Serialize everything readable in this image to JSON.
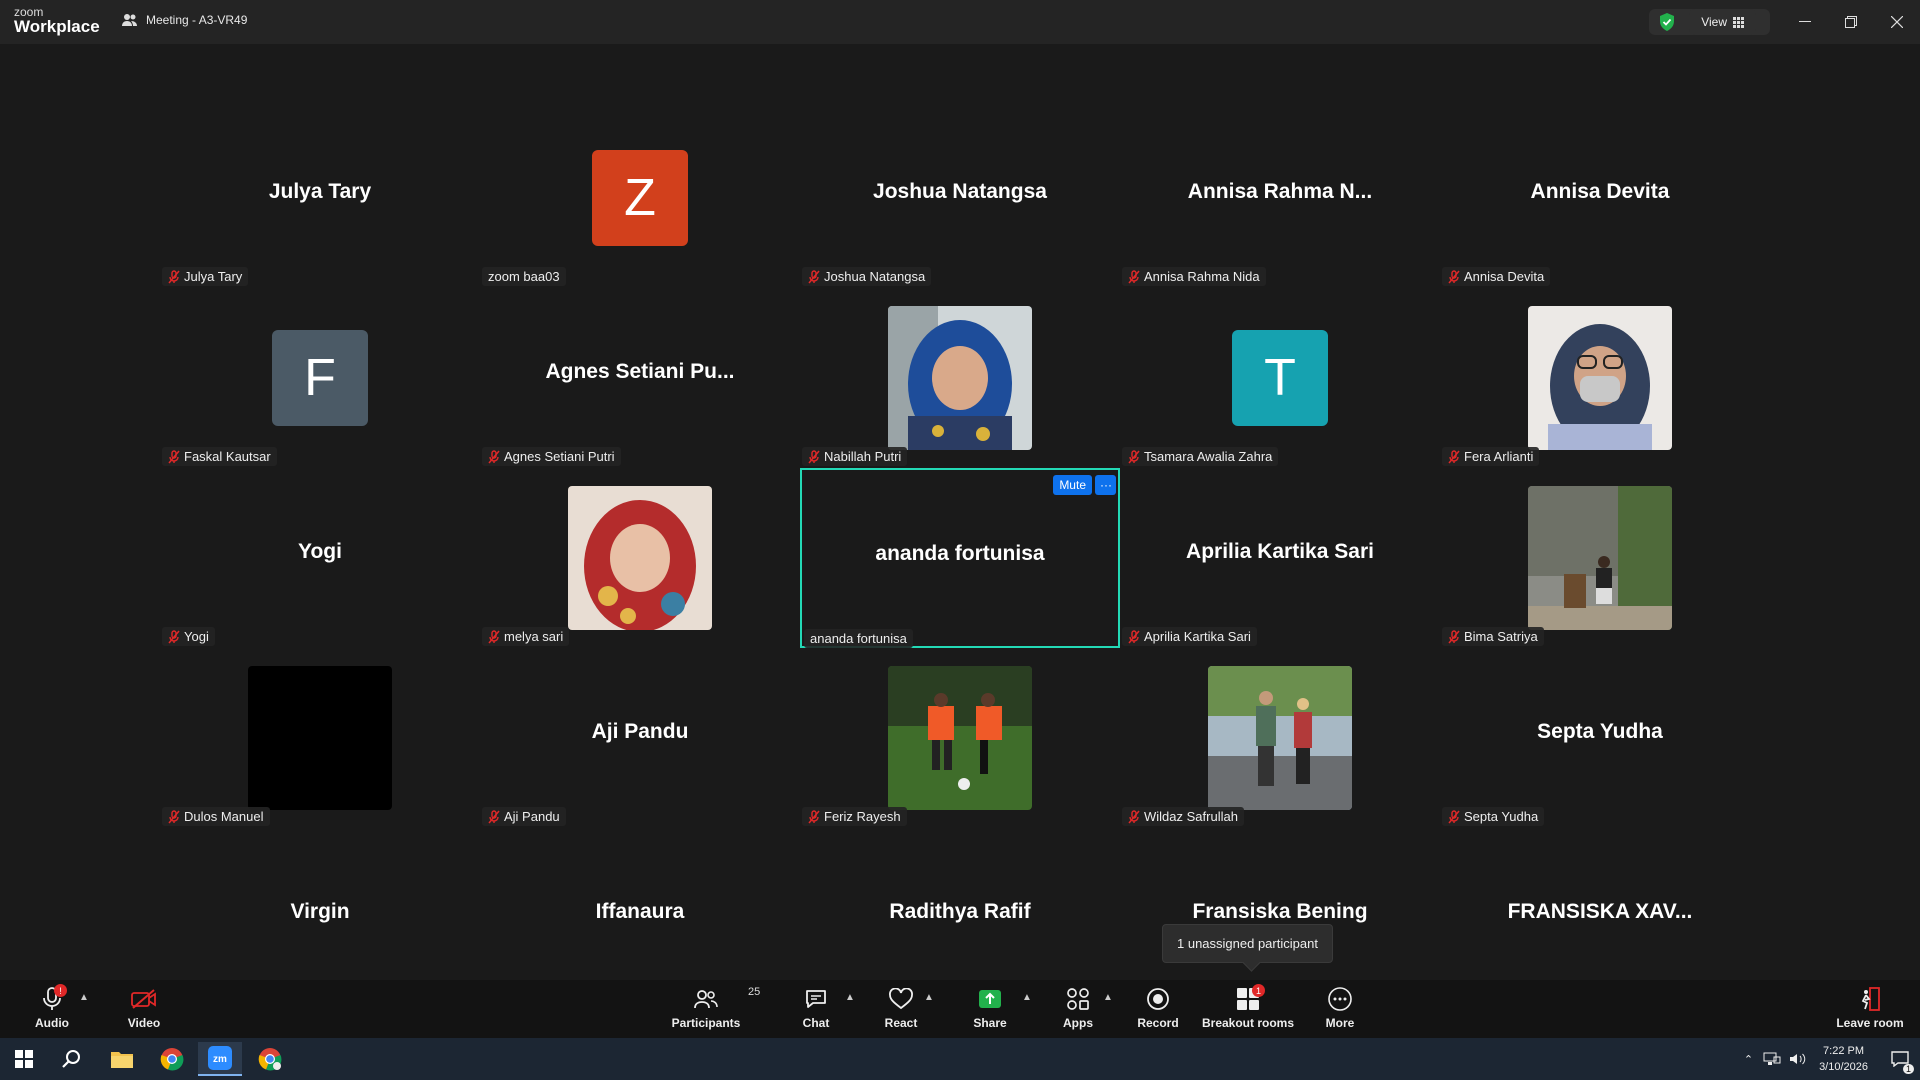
{
  "app": {
    "logo_top": "zoom",
    "logo_bottom": "Workplace",
    "meeting_title": "Meeting - A3-VR49",
    "view_label": "View"
  },
  "tiles": [
    {
      "center": "Julya Tary",
      "label": "Julya Tary",
      "muted": true
    },
    {
      "avatar_letter": "Z",
      "avatar_color": "#d2401c",
      "label": "zoom baa03",
      "muted": false
    },
    {
      "center": "Joshua Natangsa",
      "label": "Joshua Natangsa",
      "muted": true
    },
    {
      "center": "Annisa Rahma N...",
      "label": "Annisa Rahma Nida",
      "muted": true
    },
    {
      "center": "Annisa Devita",
      "label": "Annisa Devita",
      "muted": true
    },
    {
      "avatar_letter": "F",
      "avatar_color": "#4b5a66",
      "label": "Faskal Kautsar",
      "muted": true
    },
    {
      "center": "Agnes Setiani Pu...",
      "label": "Agnes Setiani Putri",
      "muted": true
    },
    {
      "photo": "portrait-blue-hijab",
      "label": "Nabillah Putri",
      "muted": true
    },
    {
      "avatar_letter": "T",
      "avatar_color": "#16a2b0",
      "label": "Tsamara Awalia Zahra",
      "muted": true
    },
    {
      "photo": "portrait-mask",
      "label": "Fera Arlianti",
      "muted": true
    },
    {
      "center": "Yogi",
      "label": "Yogi",
      "muted": true
    },
    {
      "photo": "portrait-red-hijab",
      "label": "melya sari",
      "muted": true
    },
    {
      "center": "ananda fortunisa",
      "label": "ananda fortunisa",
      "muted": false,
      "active": true,
      "mute_btn": "Mute",
      "more_btn": "···"
    },
    {
      "center": "Aprilia Kartika Sari",
      "label": "Aprilia Kartika Sari",
      "muted": true
    },
    {
      "photo": "man-stone-wall",
      "label": "Bima Satriya",
      "muted": true
    },
    {
      "photo": "black",
      "label": "Dulos Manuel",
      "muted": true
    },
    {
      "center": "Aji Pandu",
      "label": "Aji Pandu",
      "muted": true
    },
    {
      "photo": "football",
      "label": "Feriz Rayesh",
      "muted": true
    },
    {
      "photo": "couple-road",
      "label": "Wildaz Safrullah",
      "muted": true
    },
    {
      "center": "Septa Yudha",
      "label": "Septa Yudha",
      "muted": true
    },
    {
      "center": "Virgin",
      "label": "Virgin",
      "muted": true
    },
    {
      "center": "Iffanaura",
      "label": "Iffanaura",
      "muted": true
    },
    {
      "center": "Radithya Rafif",
      "label": "Radithya Rafif",
      "muted": true
    },
    {
      "center": "Fransiska Bening",
      "label": "Fra",
      "muted": true
    },
    {
      "center": "FRANSISKA  XAV...",
      "label": "FRANSISKA XAVERIA B.",
      "muted": true
    }
  ],
  "tooltip": "1 unassigned participant",
  "toolbar": {
    "audio": "Audio",
    "video": "Video",
    "participants": "Participants",
    "participants_count": "25",
    "chat": "Chat",
    "react": "React",
    "share": "Share",
    "apps": "Apps",
    "record": "Record",
    "breakout": "Breakout rooms",
    "breakout_badge": "1",
    "more": "More",
    "leave": "Leave room"
  },
  "taskbar": {
    "time": "7:22 PM",
    "date": "3/10/2026",
    "notif_count": "1"
  },
  "colors": {
    "active_border": "#23d9b6",
    "mute_button": "#0e72ed",
    "share_green": "#22b14c",
    "mic_red": "#e02828"
  }
}
